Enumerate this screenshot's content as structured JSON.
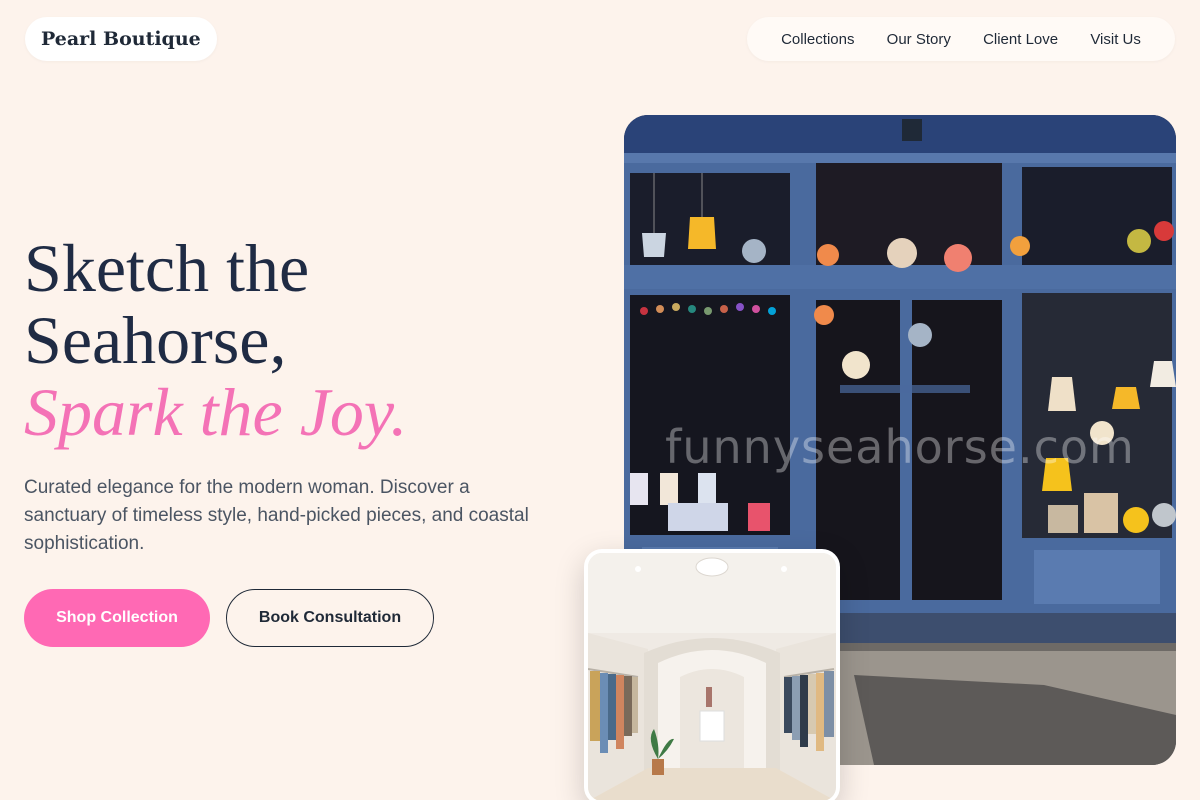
{
  "header": {
    "logo": "Pearl Boutique",
    "nav": [
      {
        "label": "Collections"
      },
      {
        "label": "Our Story"
      },
      {
        "label": "Client Love"
      },
      {
        "label": "Visit Us"
      }
    ]
  },
  "hero": {
    "title_line1": "Sketch the",
    "title_line2": "Seahorse,",
    "title_accent": "Spark the Joy.",
    "subtitle": "Curated elegance for the modern woman. Discover a sanctuary of timeless style, hand-picked pieces, and coastal sophistication.",
    "primary_button": "Shop Collection",
    "secondary_button": "Book Consultation"
  },
  "images": {
    "storefront_watermark": "funnyseahorse.com"
  },
  "colors": {
    "background": "#fdf3ec",
    "accent_pink": "#ff69b4",
    "title_navy": "#1f2b44",
    "storefront_blue": "#4a6a9e"
  }
}
